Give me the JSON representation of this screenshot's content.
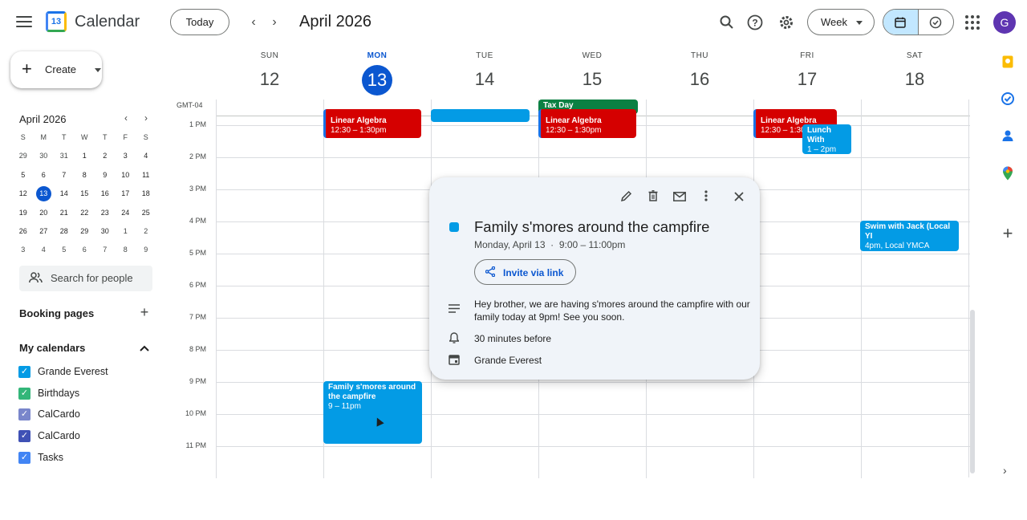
{
  "header": {
    "app_title": "Calendar",
    "logo_day": "13",
    "today_label": "Today",
    "month_title": "April 2026",
    "view_label": "Week",
    "avatar_initial": "G"
  },
  "icons": {
    "menu": "hamburger-icon",
    "prev": "chevron-left-icon",
    "next": "chevron-right-icon",
    "search": "search-icon",
    "help": "help-icon",
    "settings": "gear-icon",
    "calendar_view": "calendar-icon",
    "tasks_view": "task-check-icon",
    "apps": "apps-grid-icon"
  },
  "sidebar": {
    "create_label": "Create",
    "mini_calendar": {
      "title": "April 2026",
      "weekday_heads": [
        "S",
        "M",
        "T",
        "W",
        "T",
        "F",
        "S"
      ],
      "weeks": [
        [
          "29",
          "30",
          "31",
          "1",
          "2",
          "3",
          "4"
        ],
        [
          "5",
          "6",
          "7",
          "8",
          "9",
          "10",
          "11"
        ],
        [
          "12",
          "13",
          "14",
          "15",
          "16",
          "17",
          "18"
        ],
        [
          "19",
          "20",
          "21",
          "22",
          "23",
          "24",
          "25"
        ],
        [
          "26",
          "27",
          "28",
          "29",
          "30",
          "1",
          "2"
        ],
        [
          "3",
          "4",
          "5",
          "6",
          "7",
          "8",
          "9"
        ]
      ],
      "selected": "13"
    },
    "search_people_placeholder": "Search for people",
    "booking_pages_label": "Booking pages",
    "my_calendars_label": "My calendars",
    "calendars": [
      {
        "name": "Grande Everest",
        "color": "#039be5"
      },
      {
        "name": "Birthdays",
        "color": "#33b679"
      },
      {
        "name": "CalCardo",
        "color": "#7986cb"
      },
      {
        "name": "CalCardo",
        "color": "#3f51b5"
      },
      {
        "name": "Tasks",
        "color": "#4285f4"
      }
    ]
  },
  "week": {
    "timezone": "GMT-04",
    "days": [
      {
        "dow": "SUN",
        "num": "12"
      },
      {
        "dow": "MON",
        "num": "13",
        "today": true
      },
      {
        "dow": "TUE",
        "num": "14"
      },
      {
        "dow": "WED",
        "num": "15"
      },
      {
        "dow": "THU",
        "num": "16"
      },
      {
        "dow": "FRI",
        "num": "17"
      },
      {
        "dow": "SAT",
        "num": "18"
      }
    ],
    "hours": [
      "1 PM",
      "2 PM",
      "3 PM",
      "4 PM",
      "5 PM",
      "6 PM",
      "7 PM",
      "8 PM",
      "9 PM",
      "10 PM",
      "11 PM"
    ],
    "events": [
      {
        "title": "Linear Algebra",
        "time": "12:30 – 1:30pm",
        "color": "#d50000"
      },
      {
        "title": "Tax Day",
        "time": "",
        "color": "#0b8043"
      },
      {
        "title": "Linear Algebra",
        "time": "12:30 – 1:30pm",
        "color": "#d50000"
      },
      {
        "title": "Linear Algebra",
        "time": "12:30 – 1:30",
        "color": "#d50000"
      },
      {
        "title": "Lunch With",
        "time": "1 – 2pm",
        "color": "#039be5"
      },
      {
        "title": "Swim with Jack (Local YI",
        "time": "4pm, Local YMCA",
        "color": "#039be5"
      },
      {
        "title": "Family s'mores around the campfire",
        "time": "9 – 11pm",
        "color": "#039be5"
      }
    ]
  },
  "popup": {
    "title": "Family s'mores around the campfire",
    "date": "Monday, April 13",
    "separator": "·",
    "time": "9:00 – 11:00pm",
    "invite_label": "Invite via link",
    "description": "Hey brother, we are having s'mores around the campfire with our family today at 9pm! See you soon.",
    "reminder": "30 minutes before",
    "calendar": "Grande Everest",
    "color": "#039be5"
  }
}
